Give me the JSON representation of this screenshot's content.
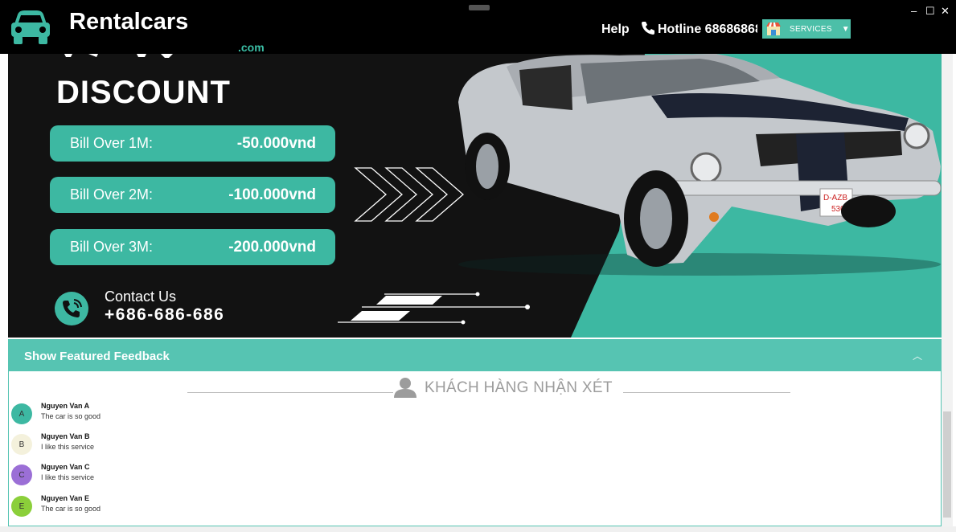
{
  "header": {
    "brand": "Rentalcars",
    "brand_suffix": ".com",
    "help": "Help",
    "hotline": "Hotline 68686868",
    "services_label": "SERVICES",
    "window_controls": {
      "minimize": "–",
      "maximize": "☐",
      "close": "✕"
    }
  },
  "banner": {
    "title": "DISCOUNT",
    "discounts": [
      {
        "label": "Bill Over 1M:",
        "amount": "-50.000vnd"
      },
      {
        "label": "Bill Over 2M:",
        "amount": "-100.000vnd"
      },
      {
        "label": "Bill Over 3M:",
        "amount": "-200.000vnd"
      }
    ],
    "contact_label": "Contact Us",
    "contact_phone": "+686-686-686",
    "plate_line1": "D-AZB",
    "plate_line2": "530"
  },
  "feedback": {
    "toggle_label": "Show Featured Feedback",
    "heading": "KHÁCH HÀNG NHẬN XÉT",
    "items": [
      {
        "initial": "A",
        "name": "Nguyen Van A",
        "comment": "The car is so good",
        "color": "#3db8a2"
      },
      {
        "initial": "B",
        "name": "Nguyen Van B",
        "comment": "I like this service",
        "color": "#f4f1dc"
      },
      {
        "initial": "C",
        "name": "Nguyen Van C",
        "comment": "I like this service",
        "color": "#9b6fd6"
      },
      {
        "initial": "E",
        "name": "Nguyen Van E",
        "comment": "The car is so good",
        "color": "#8bcf3a"
      }
    ]
  },
  "colors": {
    "accent": "#3db8a2",
    "header_bg": "#000000",
    "banner_bg": "#121212"
  }
}
